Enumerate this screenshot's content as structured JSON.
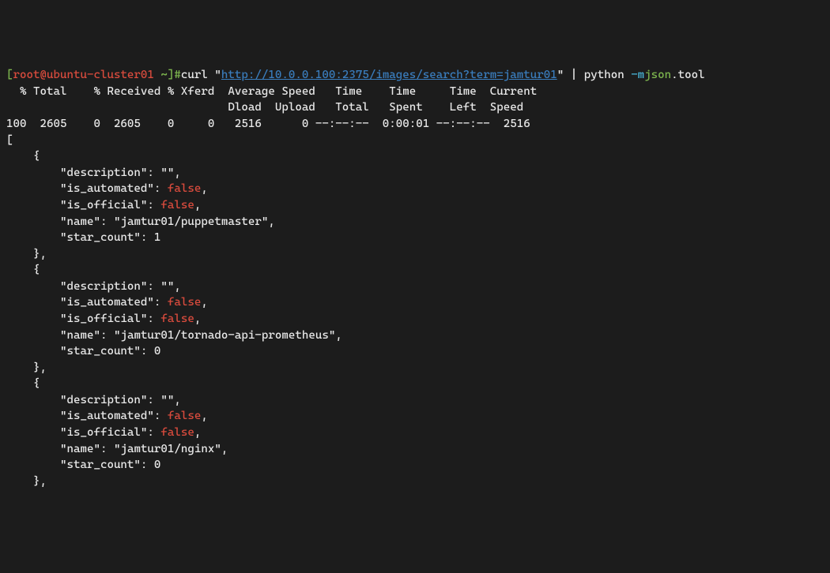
{
  "prompt": {
    "bracket_open": "[",
    "user_host": "root@ubuntu-cluster01",
    "path": " ~",
    "bracket_close": "]#",
    "cmd_curl": "curl ",
    "quote": "\"",
    "url": "http://10.0.0.100:2375/images/search?term=jamtur01",
    "pipe": " | python ",
    "flag": "-m",
    "module": "json",
    "tool": ".tool"
  },
  "headers": {
    "line1": "  % Total    % Received % Xferd  Average Speed   Time    Time     Time  Current",
    "line2": "                                 Dload  Upload   Total   Spent    Left  Speed",
    "line3": "100  2605    0  2605    0     0   2516      0 --:--:--  0:00:01 --:--:--  2516"
  },
  "json": {
    "open": "[",
    "objects": [
      {
        "description": "\"\"",
        "is_automated": "false",
        "is_official": "false",
        "name": "\"jamtur01/puppetmaster\"",
        "star_count": "1"
      },
      {
        "description": "\"\"",
        "is_automated": "false",
        "is_official": "false",
        "name": "\"jamtur01/tornado-api-prometheus\"",
        "star_count": "0"
      },
      {
        "description": "\"\"",
        "is_automated": "false",
        "is_official": "false",
        "name": "\"jamtur01/nginx\"",
        "star_count": "0"
      }
    ]
  }
}
